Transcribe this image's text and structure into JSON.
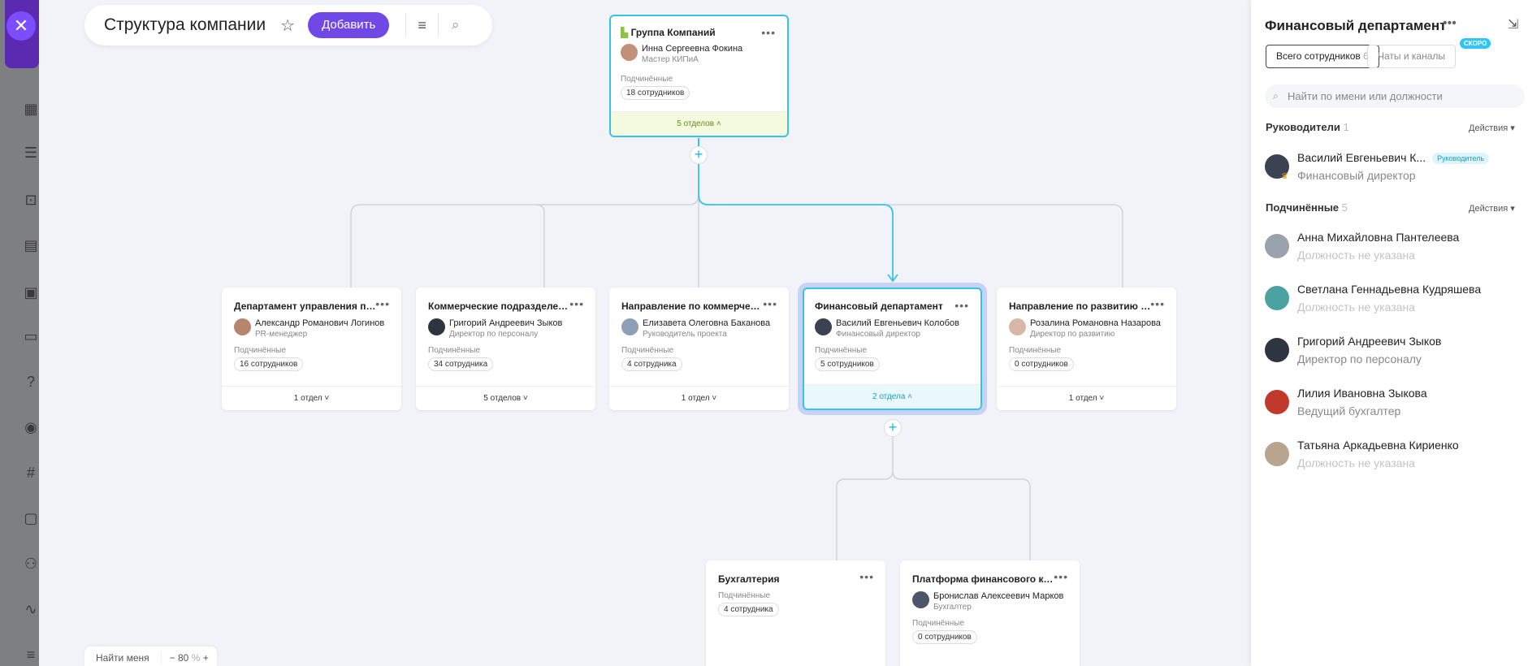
{
  "header": {
    "title": "Структура компании",
    "add_label": "Добавить"
  },
  "root": {
    "title": "Группа Компаний",
    "person": "Инна Сергеевна Фокина",
    "role": "Мастер КИПиА",
    "sub_label": "Подчинённые",
    "count": "18 сотрудников",
    "footer": "5 отделов"
  },
  "level1": [
    {
      "title": "Департамент управления перс...",
      "person": "Александр Романович Логинов",
      "role": "PR-менеджер",
      "sub_label": "Подчинённые",
      "count": "16 сотрудников",
      "footer": "1 отдел"
    },
    {
      "title": "Коммерческие подразделения",
      "person": "Григорий Андреевич Зыков",
      "role": "Директор по персоналу",
      "sub_label": "Подчинённые",
      "count": "34 сотрудника",
      "footer": "5 отделов"
    },
    {
      "title": "Направление по коммерческ...",
      "person": "Елизавета Олеговна Баканова",
      "role": "Руководитель проекта",
      "sub_label": "Подчинённые",
      "count": "4 сотрудника",
      "footer": "1 отдел"
    },
    {
      "title": "Финансовый департамент",
      "person": "Василий Евгеньевич Колобов",
      "role": "Финансовый директор",
      "sub_label": "Подчинённые",
      "count": "5 сотрудников",
      "footer": "2 отдела"
    },
    {
      "title": "Направление по развитию би...",
      "person": "Розалина Романовна Назарова",
      "role": "Директор по развитию",
      "sub_label": "Подчинённые",
      "count": "0 сотрудников",
      "footer": "1 отдел"
    }
  ],
  "level2": [
    {
      "title": "Бухгалтерия",
      "sub_label": "Подчинённые",
      "count": "4 сотрудника"
    },
    {
      "title": "Платформа финансового конт...",
      "person": "Бронислав Алексеевич Марков",
      "role": "Бухгалтер",
      "sub_label": "Подчинённые",
      "count": "0 сотрудников"
    }
  ],
  "bottom": {
    "find_me": "Найти меня",
    "minus": "−",
    "zoom": "80",
    "zoom_unit": "%",
    "plus": "+"
  },
  "panel": {
    "title": "Финансовый департамент",
    "tab_all": "Всего сотрудников",
    "tab_all_count": "6",
    "tab_chats": "Чаты и каналы",
    "soon": "СКОРО",
    "search_placeholder": "Найти по имени или должности",
    "managers_label": "Руководители",
    "managers_count": "1",
    "actions_label": "Действия",
    "subordinates_label": "Подчинённые",
    "subordinates_count": "5",
    "manager": {
      "name": "Василий Евгеньевич К...",
      "role": "Финансовый директор",
      "badge": "Руководитель"
    },
    "employees": [
      {
        "name": "Анна Михайловна Пантелеева",
        "role": "Должность не указана"
      },
      {
        "name": "Светлана Геннадьевна Кудряшева",
        "role": "Должность не указана"
      },
      {
        "name": "Григорий Андреевич Зыков",
        "role": "Директор по персоналу"
      },
      {
        "name": "Лилия Ивановна Зыкова",
        "role": "Ведущий бухгалтер"
      },
      {
        "name": "Татьяна Аркадьевна Кириенко",
        "role": "Должность не указана"
      }
    ]
  },
  "colors": {
    "accent": "#7048e8",
    "selected": "#35c4e9",
    "root_footer": "#f3fadf"
  }
}
